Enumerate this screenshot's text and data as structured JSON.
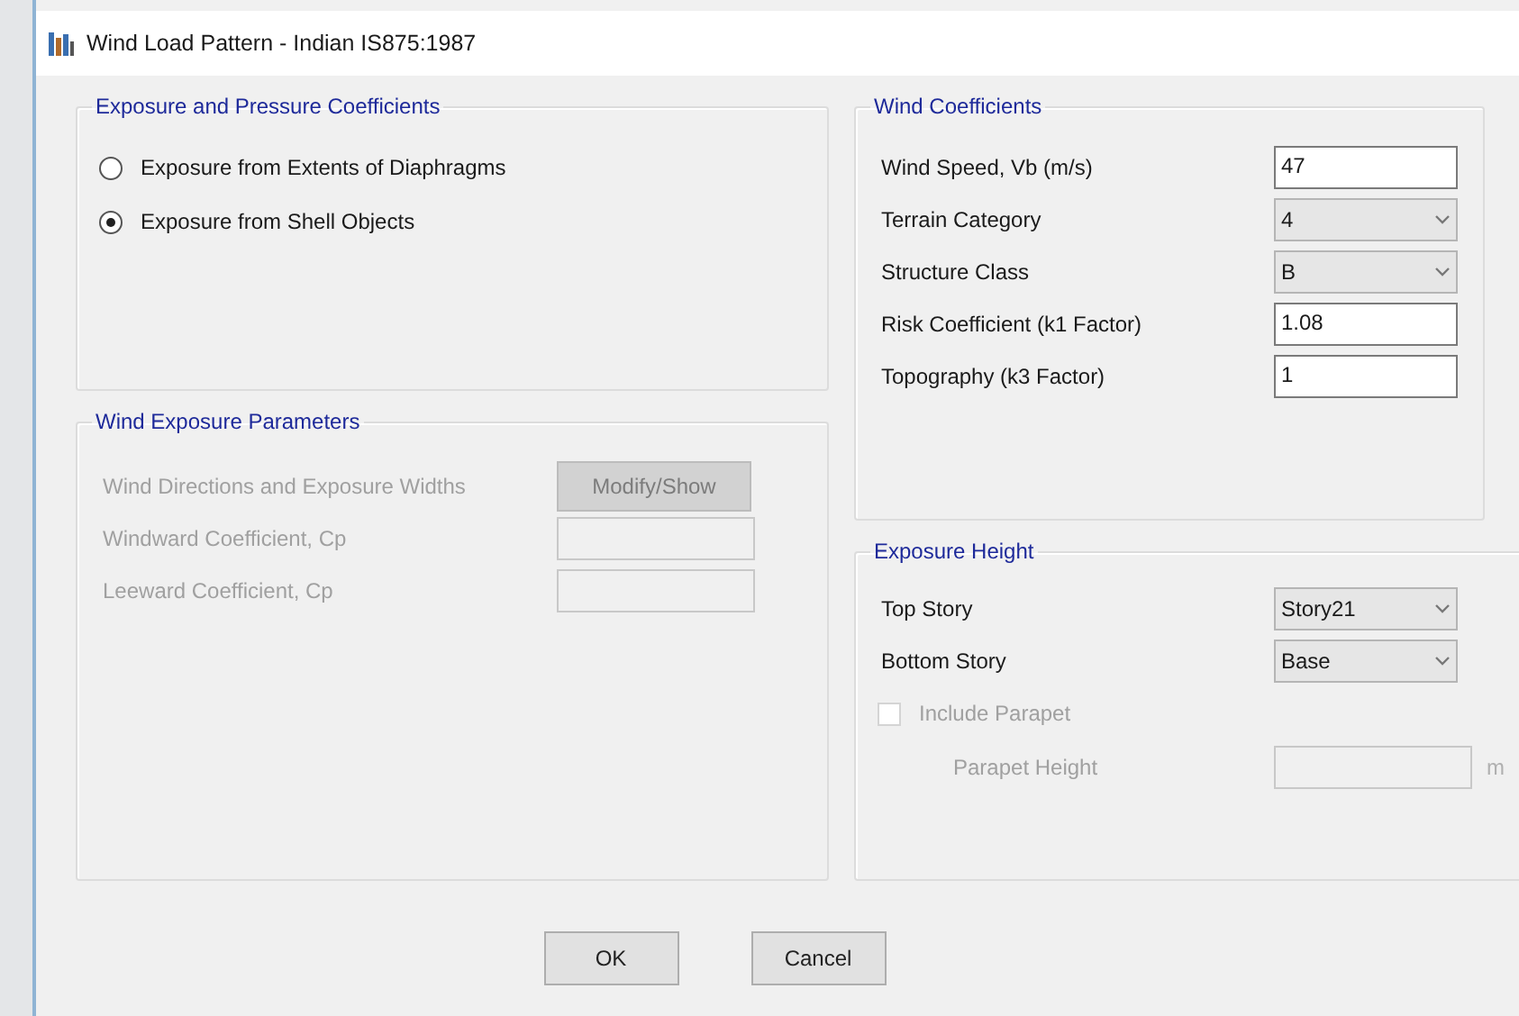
{
  "window": {
    "title": "Wind Load Pattern - Indian IS875:1987"
  },
  "exposure_coefficients": {
    "title": "Exposure and Pressure Coefficients",
    "options": [
      {
        "label": "Exposure from Extents of Diaphragms",
        "selected": false
      },
      {
        "label": "Exposure from Shell Objects",
        "selected": true
      }
    ]
  },
  "wind_exposure_parameters": {
    "title": "Wind Exposure Parameters",
    "disabled": true,
    "rows": [
      {
        "kind": "button",
        "label": "Wind Directions and Exposure Widths",
        "button": "Modify/Show"
      },
      {
        "kind": "input",
        "label": "Windward Coefficient, Cp"
      },
      {
        "kind": "input",
        "label": "Leeward Coefficient, Cp"
      }
    ]
  },
  "wind_coefficients": {
    "title": "Wind Coefficients",
    "fields": [
      {
        "kind": "input",
        "label": "Wind Speed, Vb (m/s)",
        "value": "47"
      },
      {
        "kind": "dropdown",
        "label": "Terrain Category",
        "value": "4"
      },
      {
        "kind": "dropdown",
        "label": "Structure Class",
        "value": "B"
      },
      {
        "kind": "input",
        "label": "Risk Coefficient (k1 Factor)",
        "value": "1.08"
      },
      {
        "kind": "input",
        "label": "Topography (k3 Factor)",
        "value": "1"
      }
    ]
  },
  "exposure_height": {
    "title": "Exposure Height",
    "fields": [
      {
        "kind": "dropdown",
        "label": "Top Story",
        "value": "Story21"
      },
      {
        "kind": "dropdown",
        "label": "Bottom Story",
        "value": "Base"
      }
    ],
    "parapet": {
      "label": "Include Parapet",
      "checked": false,
      "disabled": true
    },
    "parapet_height": {
      "label": "Parapet Height",
      "unit": "m",
      "disabled": true
    }
  },
  "buttons": [
    {
      "label": "OK"
    },
    {
      "label": "Cancel"
    }
  ]
}
